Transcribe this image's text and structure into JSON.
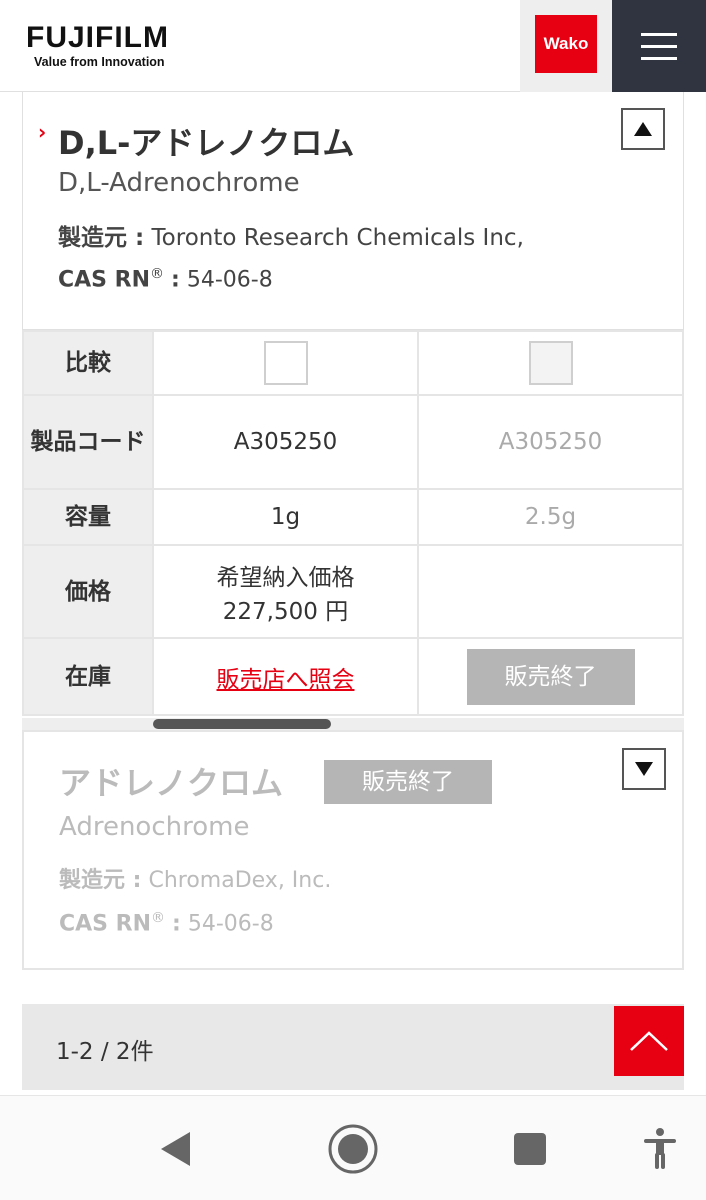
{
  "header": {
    "logo_text": "FUJIFILM",
    "logo_tagline": "Value from Innovation",
    "wako_label": "Wako",
    "menu_icon": "hamburger-icon"
  },
  "product1": {
    "name": "D,L-アドレノクロム",
    "english_name": "D,L-Adrenochrome",
    "maker_label": "製造元 :",
    "maker_value": "Toronto Research Chemicals Inc,",
    "cas_label": "CAS RN",
    "cas_mark": "®",
    "cas_sep": ":",
    "cas_value": "54-06-8",
    "toggle_icon": "triangle-up-icon"
  },
  "table": {
    "row_compare": "比較",
    "row_code": "製品コード",
    "row_volume": "容量",
    "row_price": "価格",
    "row_stock": "在庫",
    "col1": {
      "code": "A305250",
      "volume": "1g",
      "price_label": "希望納入価格",
      "price_value": "227,500 円",
      "stock_link": "販売店へ照会"
    },
    "col2": {
      "code": "A305250",
      "volume": "2.5g",
      "stock_status": "販売終了"
    }
  },
  "product2": {
    "name": "アドレノクロム",
    "badge": "販売終了",
    "english_name": "Adrenochrome",
    "maker_label": "製造元 :",
    "maker_value": "ChromaDex, Inc.",
    "cas_label": "CAS RN",
    "cas_mark": "®",
    "cas_sep": ":",
    "cas_value": "54-06-8",
    "toggle_icon": "triangle-down-icon"
  },
  "pager": {
    "count": "1-2 / 2件"
  },
  "colors": {
    "brand_red": "#e60012",
    "menu_dark": "#2f3440",
    "disabled_gray": "#b5b5b5"
  }
}
